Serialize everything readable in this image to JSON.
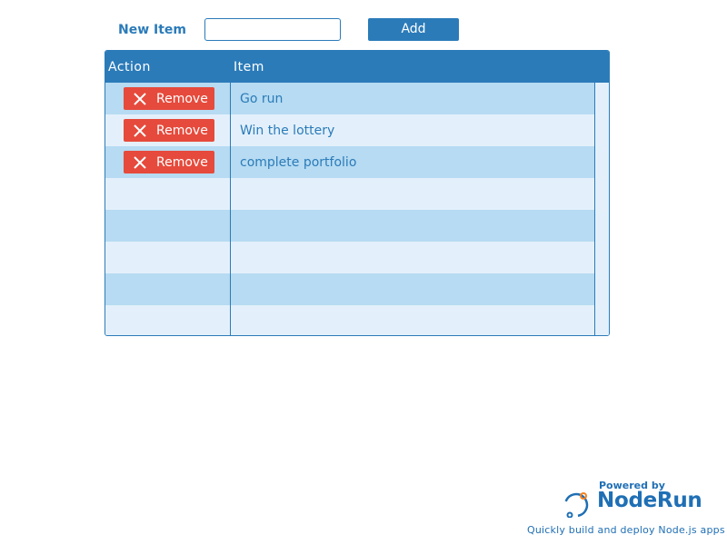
{
  "form": {
    "new_item_label": "New Item",
    "new_item_value": "",
    "add_label": "Add"
  },
  "grid": {
    "columns": [
      "Action",
      "Item"
    ],
    "rows": [
      {
        "remove_label": "Remove",
        "item": "Go run"
      },
      {
        "remove_label": "Remove",
        "item": "Win the lottery"
      },
      {
        "remove_label": "Remove",
        "item": "complete portfolio"
      }
    ],
    "empty_rows": 5
  },
  "footer": {
    "powered_by": "Powered by",
    "brand": "NodeRun",
    "tagline": "Quickly build and deploy Node.js apps"
  },
  "colors": {
    "primary": "#2b7bb9",
    "row_alt": "#b6dbf2",
    "row_base": "#e3f0fb",
    "remove": "#e64a3c",
    "brand_orange": "#f58220"
  }
}
